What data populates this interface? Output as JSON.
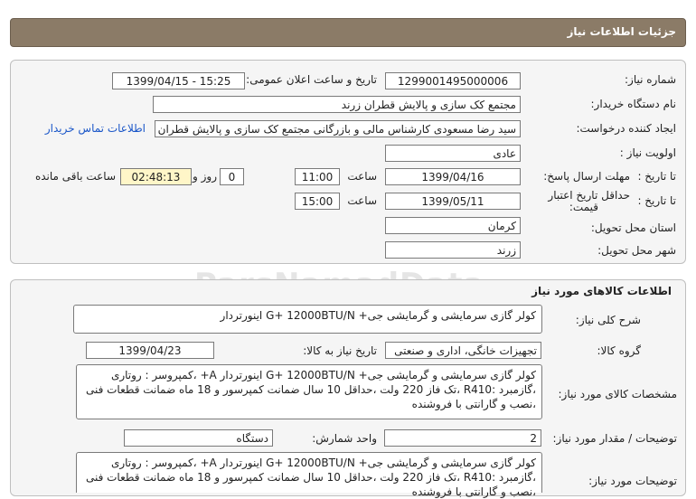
{
  "header": {
    "title": "جزئیات اطلاعات نیاز"
  },
  "need_info": {
    "need_number_label": "شماره نیاز:",
    "need_number": "1299001495000006",
    "announce_label": "تاریخ و ساعت اعلان عمومی:",
    "announce_value": "1399/04/15 - 15:25",
    "buyer_org_label": "نام دستگاه خریدار:",
    "buyer_org": "مجتمع کک سازی و پالایش قطران زرند",
    "requester_label": "ایجاد کننده درخواست:",
    "requester": "سید رضا مسعودی کارشناس مالی و بازرگانی مجتمع کک سازی و پالایش قطران زرند",
    "contact_link": "اطلاعات تماس خریدار",
    "priority_label": "اولویت نیاز :",
    "priority": "عادی",
    "deadline_label": "مهلت ارسال پاسخ:",
    "to_date_label": "تا تاریخ :",
    "deadline_date": "1399/04/16",
    "time_label": "ساعت",
    "deadline_time": "11:00",
    "days_value": "0",
    "days_label": "روز و",
    "remaining_time": "02:48:13",
    "remaining_label": "ساعت باقی مانده",
    "price_validity_label_1": "حداقل تاریخ اعتبار",
    "price_validity_label_2": "قیمت:",
    "price_to_date_label": "تا تاریخ :",
    "price_date": "1399/05/11",
    "price_time_label": "ساعت",
    "price_time": "15:00",
    "province_label": "استان محل تحویل:",
    "province": "کرمان",
    "city_label": "شهر محل تحویل:",
    "city": "زرند"
  },
  "goods": {
    "section_title": "اطلاعات کالاهای مورد نیاز",
    "general_desc_label": "شرح کلی نیاز:",
    "general_desc": "کولر گازی سرمایشی و گرمایشی  جی+ G+ 12000BTU/N  اینورتردار",
    "group_label": "گروه کالا:",
    "group": "تجهیزات خانگی، اداری و صنعتی",
    "need_date_label": "تاریخ نیاز به کالا:",
    "need_date": "1399/04/23",
    "specs_label": "مشخصات کالای مورد نیاز:",
    "specs": "کولر گازی سرمایشی و گرمایشی  جی+ G+ 12000BTU/N اینورتردار A+ ،کمپروسر : روتاری ،گازمبرد :R410 ،تک فاز 220 ولت ،حداقل 10 سال ضمانت کمپرسور و 18 ماه ضمانت قطعات فنی ،نصب و گارانتی با فروشنده",
    "qty_label": "توضیحات / مقدار مورد نیاز:",
    "qty": "2",
    "unit_label": "واحد شمارش:",
    "unit": "دستگاه",
    "notes_label": "توضیحات مورد نیاز:",
    "notes": "کولر گازی سرمایشی و گرمایشی  جی+ G+ 12000BTU/N اینورتردار A+ ،کمپروسر : روتاری ،گازمبرد :R410 ،تک فاز 220 ولت ،حداقل 10 سال ضمانت کمپرسور و 18 ماه ضمانت قطعات فنی ،نصب و گارانتی با فروشنده"
  },
  "watermark": {
    "text": "ParsNamadData"
  }
}
